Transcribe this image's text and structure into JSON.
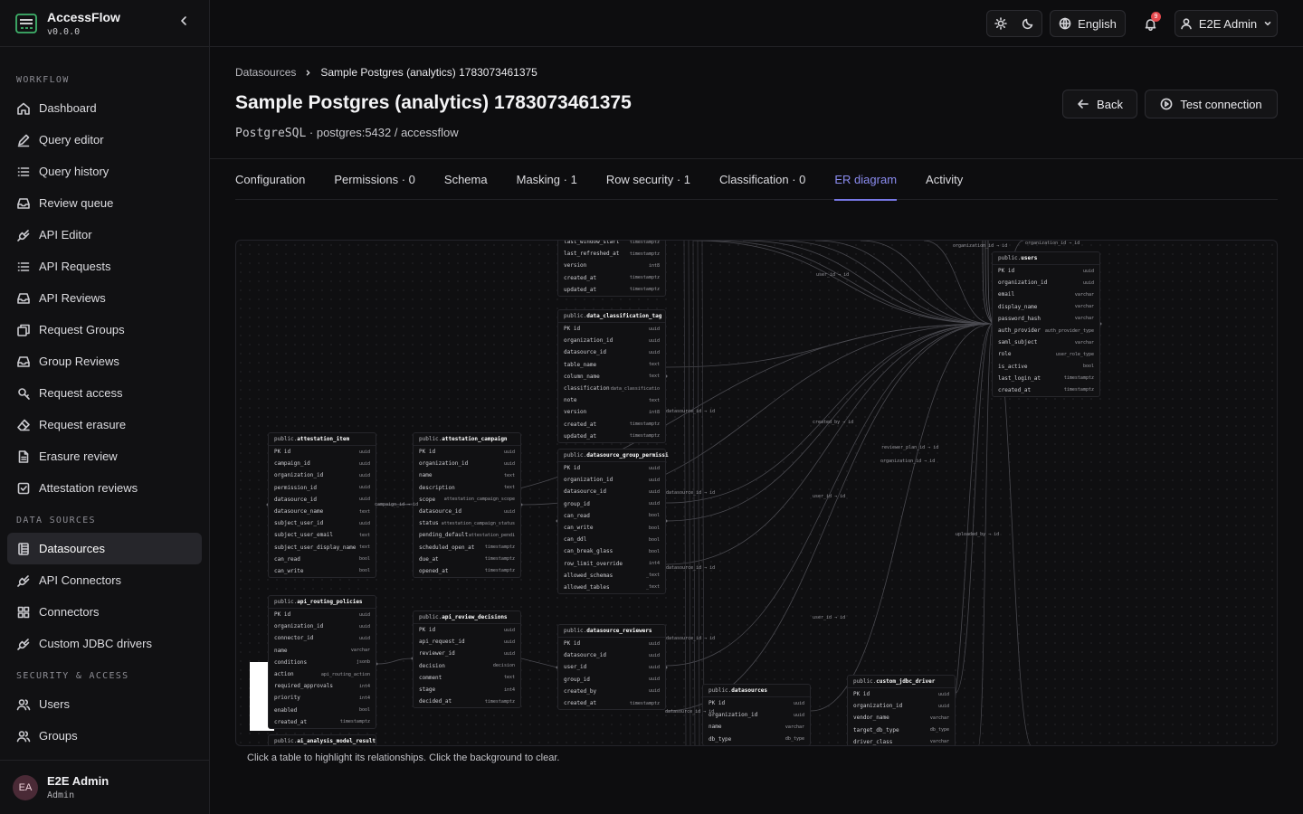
{
  "app": {
    "name": "AccessFlow",
    "version": "v0.0.0"
  },
  "sidebar": {
    "sections": [
      {
        "label": "WORKFLOW",
        "items": [
          {
            "label": "Dashboard",
            "icon": "home-icon"
          },
          {
            "label": "Query editor",
            "icon": "pencil-icon"
          },
          {
            "label": "Query history",
            "icon": "list-icon"
          },
          {
            "label": "Review queue",
            "icon": "inbox-icon"
          },
          {
            "label": "API Editor",
            "icon": "plug-icon"
          },
          {
            "label": "API Requests",
            "icon": "list-icon"
          },
          {
            "label": "API Reviews",
            "icon": "inbox-icon"
          },
          {
            "label": "Request Groups",
            "icon": "stack-icon"
          },
          {
            "label": "Group Reviews",
            "icon": "inbox-icon"
          },
          {
            "label": "Request access",
            "icon": "key-icon"
          },
          {
            "label": "Request erasure",
            "icon": "eraser-icon"
          },
          {
            "label": "Erasure review",
            "icon": "document-icon"
          },
          {
            "label": "Attestation reviews",
            "icon": "checkbox-icon"
          }
        ]
      },
      {
        "label": "DATA SOURCES",
        "items": [
          {
            "label": "Datasources",
            "icon": "database-icon",
            "active": true
          },
          {
            "label": "API Connectors",
            "icon": "plug-icon"
          },
          {
            "label": "Connectors",
            "icon": "grid-icon"
          },
          {
            "label": "Custom JDBC drivers",
            "icon": "plug-icon"
          }
        ]
      },
      {
        "label": "SECURITY & ACCESS",
        "items": [
          {
            "label": "Users",
            "icon": "users-icon"
          },
          {
            "label": "Groups",
            "icon": "users-icon"
          }
        ]
      }
    ],
    "user": {
      "initials": "EA",
      "name": "E2E Admin",
      "role": "Admin"
    }
  },
  "topbar": {
    "language": "English",
    "notifications": "9",
    "user": "E2E Admin"
  },
  "header": {
    "breadcrumb": [
      "Datasources",
      "Sample Postgres (analytics) 1783073461375"
    ],
    "title": "Sample Postgres (analytics) 1783073461375",
    "engine": "PostgreSQL",
    "connection": "· postgres:5432 / accessflow",
    "back_label": "Back",
    "test_label": "Test connection"
  },
  "tabs": [
    {
      "label": "Configuration"
    },
    {
      "label": "Permissions · 0"
    },
    {
      "label": "Schema"
    },
    {
      "label": "Masking · 1"
    },
    {
      "label": "Row security · 1"
    },
    {
      "label": "Classification · 0"
    },
    {
      "label": "ER diagram",
      "active": true
    },
    {
      "label": "Activity"
    }
  ],
  "er_hint": "Click a table to highlight its relationships. Click the background to clear.",
  "er_tables": [
    {
      "schema": "public.",
      "name": "",
      "cols": [
        [
          "last_window_start",
          "timestamptz"
        ],
        [
          "last_refreshed_at",
          "timestamptz"
        ],
        [
          "version",
          "int8"
        ],
        [
          "created_at",
          "timestamptz"
        ],
        [
          "updated_at",
          "timestamptz"
        ]
      ]
    },
    {
      "schema": "public.",
      "name": "data_classification_tag",
      "cols": [
        [
          "PK id",
          "uuid"
        ],
        [
          "organization_id",
          "uuid"
        ],
        [
          "datasource_id",
          "uuid"
        ],
        [
          "table_name",
          "text"
        ],
        [
          "column_name",
          "text"
        ],
        [
          "classification",
          "data_classificatio"
        ],
        [
          "note",
          "text"
        ],
        [
          "version",
          "int8"
        ],
        [
          "created_at",
          "timestamptz"
        ],
        [
          "updated_at",
          "timestamptz"
        ]
      ]
    },
    {
      "schema": "public.",
      "name": "users",
      "cols": [
        [
          "PK id",
          "uuid"
        ],
        [
          "organization_id",
          "uuid"
        ],
        [
          "email",
          "varchar"
        ],
        [
          "display_name",
          "varchar"
        ],
        [
          "password_hash",
          "varchar"
        ],
        [
          "auth_provider",
          "auth_provider_type"
        ],
        [
          "saml_subject",
          "varchar"
        ],
        [
          "role",
          "user_role_type"
        ],
        [
          "is_active",
          "bool"
        ],
        [
          "last_login_at",
          "timestamptz"
        ],
        [
          "created_at",
          "timestamptz"
        ]
      ]
    },
    {
      "schema": "public.",
      "name": "attestation_item",
      "cols": [
        [
          "PK id",
          "uuid"
        ],
        [
          "campaign_id",
          "uuid"
        ],
        [
          "organization_id",
          "uuid"
        ],
        [
          "permission_id",
          "uuid"
        ],
        [
          "datasource_id",
          "uuid"
        ],
        [
          "datasource_name",
          "text"
        ],
        [
          "subject_user_id",
          "uuid"
        ],
        [
          "subject_user_email",
          "text"
        ],
        [
          "subject_user_display_name",
          "text"
        ],
        [
          "can_read",
          "bool"
        ],
        [
          "can_write",
          "bool"
        ]
      ]
    },
    {
      "schema": "public.",
      "name": "attestation_campaign",
      "cols": [
        [
          "PK id",
          "uuid"
        ],
        [
          "organization_id",
          "uuid"
        ],
        [
          "name",
          "text"
        ],
        [
          "description",
          "text"
        ],
        [
          "scope",
          "attestation_campaign_scope"
        ],
        [
          "datasource_id",
          "uuid"
        ],
        [
          "status",
          "attestation_campaign_status"
        ],
        [
          "pending_default",
          "attestation_pendi"
        ],
        [
          "scheduled_open_at",
          "timestamptz"
        ],
        [
          "due_at",
          "timestamptz"
        ],
        [
          "opened_at",
          "timestamptz"
        ]
      ]
    },
    {
      "schema": "public.",
      "name": "datasource_group_permissi",
      "cols": [
        [
          "PK id",
          "uuid"
        ],
        [
          "organization_id",
          "uuid"
        ],
        [
          "datasource_id",
          "uuid"
        ],
        [
          "group_id",
          "uuid"
        ],
        [
          "can_read",
          "bool"
        ],
        [
          "can_write",
          "bool"
        ],
        [
          "can_ddl",
          "bool"
        ],
        [
          "can_break_glass",
          "bool"
        ],
        [
          "row_limit_override",
          "int4"
        ],
        [
          "allowed_schemas",
          "_text"
        ],
        [
          "allowed_tables",
          "_text"
        ]
      ]
    },
    {
      "schema": "public.",
      "name": "api_routing_policies",
      "cols": [
        [
          "PK id",
          "uuid"
        ],
        [
          "organization_id",
          "uuid"
        ],
        [
          "connector_id",
          "uuid"
        ],
        [
          "name",
          "varchar"
        ],
        [
          "conditions",
          "jsonb"
        ],
        [
          "action",
          "api_routing_action"
        ],
        [
          "required_approvals",
          "int4"
        ],
        [
          "priority",
          "int4"
        ],
        [
          "enabled",
          "bool"
        ],
        [
          "created_at",
          "timestamptz"
        ]
      ]
    },
    {
      "schema": "public.",
      "name": "api_review_decisions",
      "cols": [
        [
          "PK id",
          "uuid"
        ],
        [
          "api_request_id",
          "uuid"
        ],
        [
          "reviewer_id",
          "uuid"
        ],
        [
          "decision",
          "decision"
        ],
        [
          "comment",
          "text"
        ],
        [
          "stage",
          "int4"
        ],
        [
          "decided_at",
          "timestamptz"
        ]
      ]
    },
    {
      "schema": "public.",
      "name": "datasource_reviewers",
      "cols": [
        [
          "PK id",
          "uuid"
        ],
        [
          "datasource_id",
          "uuid"
        ],
        [
          "user_id",
          "uuid"
        ],
        [
          "group_id",
          "uuid"
        ],
        [
          "created_by",
          "uuid"
        ],
        [
          "created_at",
          "timestamptz"
        ]
      ]
    },
    {
      "schema": "public.",
      "name": "datasources",
      "cols": [
        [
          "PK id",
          "uuid"
        ],
        [
          "organization_id",
          "uuid"
        ],
        [
          "name",
          "varchar"
        ],
        [
          "db_type",
          "db_type"
        ]
      ]
    },
    {
      "schema": "public.",
      "name": "custom_jdbc_driver",
      "cols": [
        [
          "PK id",
          "uuid"
        ],
        [
          "organization_id",
          "uuid"
        ],
        [
          "vendor_name",
          "varchar"
        ],
        [
          "target_db_type",
          "db_type"
        ],
        [
          "driver_class",
          "varchar"
        ]
      ]
    },
    {
      "schema": "public.",
      "name": "ai_analysis_model_result",
      "cols": []
    }
  ],
  "er_edge_labels": [
    "organization_id → id",
    "organization_id → id",
    "user_id → id",
    "datasource_id → id",
    "created_by → id",
    "reviewer_plan_id → id",
    "organization_id → id",
    "campaign_id → id",
    "datasource_id → id",
    "user_id → id",
    "datasource_id → id",
    "uploaded_by → id",
    "datasource_id → id",
    "user_id → id",
    "datasource_id → id"
  ]
}
